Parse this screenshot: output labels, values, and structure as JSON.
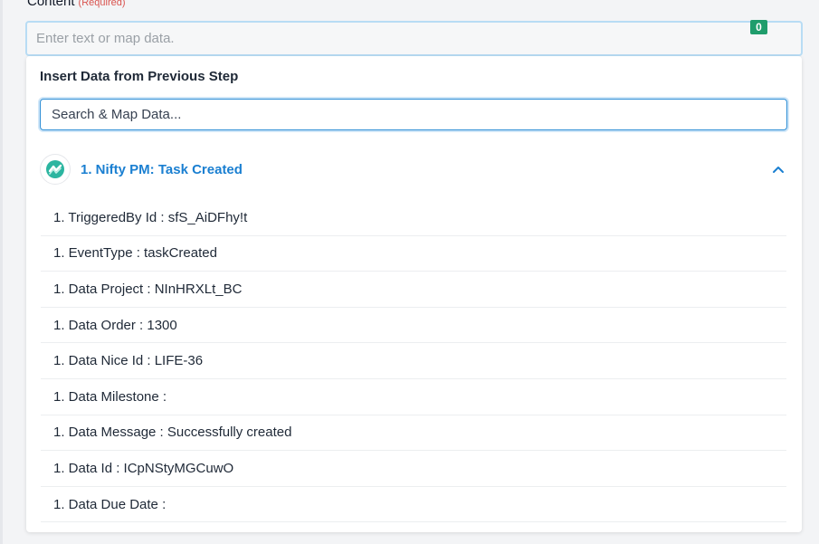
{
  "field": {
    "label": "Content",
    "required": "(Required)",
    "placeholder": "Enter text or map data.",
    "badge": "0"
  },
  "panel": {
    "title": "Insert Data from Previous Step",
    "search_placeholder": "Search & Map Data..."
  },
  "step": {
    "title": "1. Nifty PM: Task Created",
    "logo_icon": "nifty-logo-icon",
    "expanded": true
  },
  "rows": [
    "1. TriggeredBy Id : sfS_AiDFhy!t",
    "1. EventType : taskCreated",
    "1. Data Project : NInHRXLt_BC",
    "1. Data Order : 1300",
    "1. Data Nice Id : LIFE-36",
    "1. Data Milestone :",
    "1. Data Message : Successfully created",
    "1. Data Id : ICpNStyMGCuwO",
    "1. Data Due Date :"
  ],
  "colors": {
    "accent": "#1a7fd1",
    "badge": "#1f9d6c",
    "required": "#d9534f",
    "logo": "#2bb5a0"
  }
}
